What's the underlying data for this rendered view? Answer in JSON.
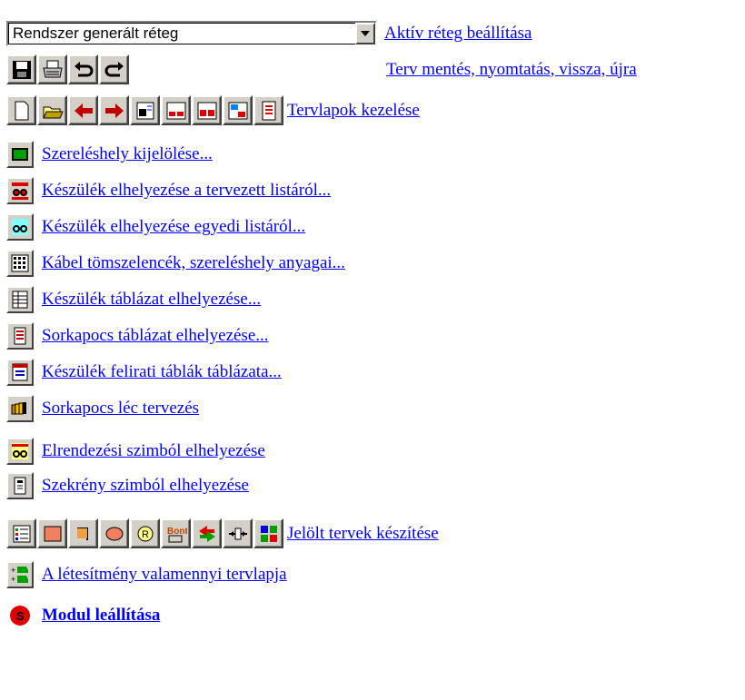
{
  "combo": {
    "value": "Rendszer generált réteg",
    "link": "Aktív réteg beállítása"
  },
  "row_save": {
    "link": "Terv mentés, nyomtatás, vissza, újra"
  },
  "row_pages": {
    "link": "Tervlapok kezelése"
  },
  "items": [
    {
      "label": "Szereléshely kijelölése...",
      "icon": "mounting-place-icon"
    },
    {
      "label": "Készülék elhelyezése a tervezett listáról...",
      "icon": "device-planned-list-icon"
    },
    {
      "label": "Készülék elhelyezése egyedi listáról...",
      "icon": "device-custom-list-icon"
    },
    {
      "label": "Kábel tömszelencék, szereléshely anyagai...",
      "icon": "cable-gland-icon"
    },
    {
      "label": "Készülék táblázat elhelyezése...",
      "icon": "device-table-icon"
    },
    {
      "label": "Sorkapocs táblázat elhelyezése...",
      "icon": "terminal-table-icon"
    },
    {
      "label": "Készülék felirati táblák táblázata...",
      "icon": "label-table-icon"
    },
    {
      "label": "Sorkapocs léc tervezés",
      "icon": "terminal-strip-icon"
    },
    {
      "label": "Elrendezési szimból elhelyezése",
      "icon": "layout-symbol-icon"
    },
    {
      "label": "Szekrény szimból elhelyezése",
      "icon": "cabinet-symbol-icon"
    }
  ],
  "row_marked": {
    "link": "Jelölt tervek készítése"
  },
  "row_all": {
    "link": "A létesítmény valamennyi tervlapja"
  },
  "row_stop": {
    "link": "Modul leállítása"
  }
}
